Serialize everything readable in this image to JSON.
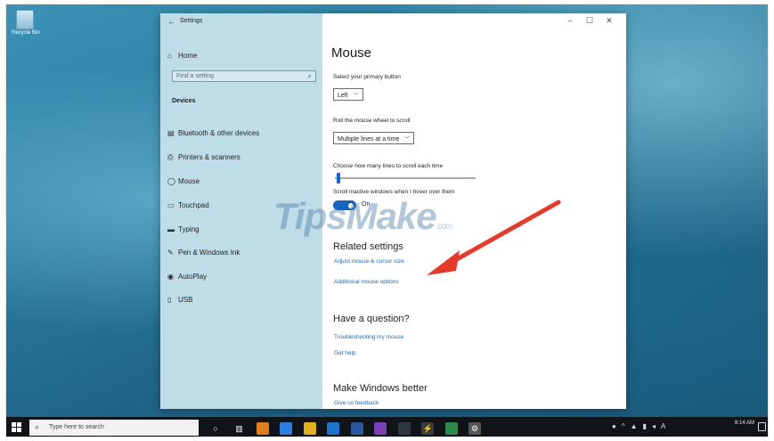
{
  "desktop": {
    "recycle_bin_label": "Recycle Bin"
  },
  "window": {
    "app_title": "Settings",
    "controls": {
      "minimize": "–",
      "maximize": "☐",
      "close": "✕"
    }
  },
  "sidebar": {
    "home_label": "Home",
    "search_placeholder": "Find a setting",
    "section_title": "Devices",
    "items": [
      {
        "label": "Bluetooth & other devices",
        "icon": "bluetooth-icon"
      },
      {
        "label": "Printers & scanners",
        "icon": "printer-icon"
      },
      {
        "label": "Mouse",
        "icon": "mouse-icon",
        "selected": true
      },
      {
        "label": "Touchpad",
        "icon": "touchpad-icon"
      },
      {
        "label": "Typing",
        "icon": "keyboard-icon"
      },
      {
        "label": "Pen & Windows Ink",
        "icon": "pen-icon"
      },
      {
        "label": "AutoPlay",
        "icon": "autoplay-icon"
      },
      {
        "label": "USB",
        "icon": "usb-icon"
      }
    ]
  },
  "main": {
    "page_title": "Mouse",
    "primary_button_label": "Select your primary button",
    "primary_button_value": "Left",
    "wheel_label": "Roll the mouse wheel to scroll",
    "wheel_value": "Multiple lines at a time",
    "lines_label": "Choose how many lines to scroll each time",
    "inactive_label": "Scroll inactive windows when I hover over them",
    "inactive_state": "On",
    "related_title": "Related settings",
    "related_links": [
      "Adjust mouse & cursor size",
      "Additional mouse options"
    ],
    "question_title": "Have a question?",
    "question_links": [
      "Troubleshooting my mouse",
      "Get help"
    ],
    "better_title": "Make Windows better",
    "better_link": "Give us feedback"
  },
  "watermark": {
    "text": "TipsMake",
    "suffix": ".com"
  },
  "taskbar": {
    "search_placeholder": "Type here to search",
    "clock_time": "8:14 AM"
  },
  "colors": {
    "accent": "#1565c0",
    "sidebar_bg": "#bfdce9",
    "annotation_arrow": "#e53b2c"
  }
}
